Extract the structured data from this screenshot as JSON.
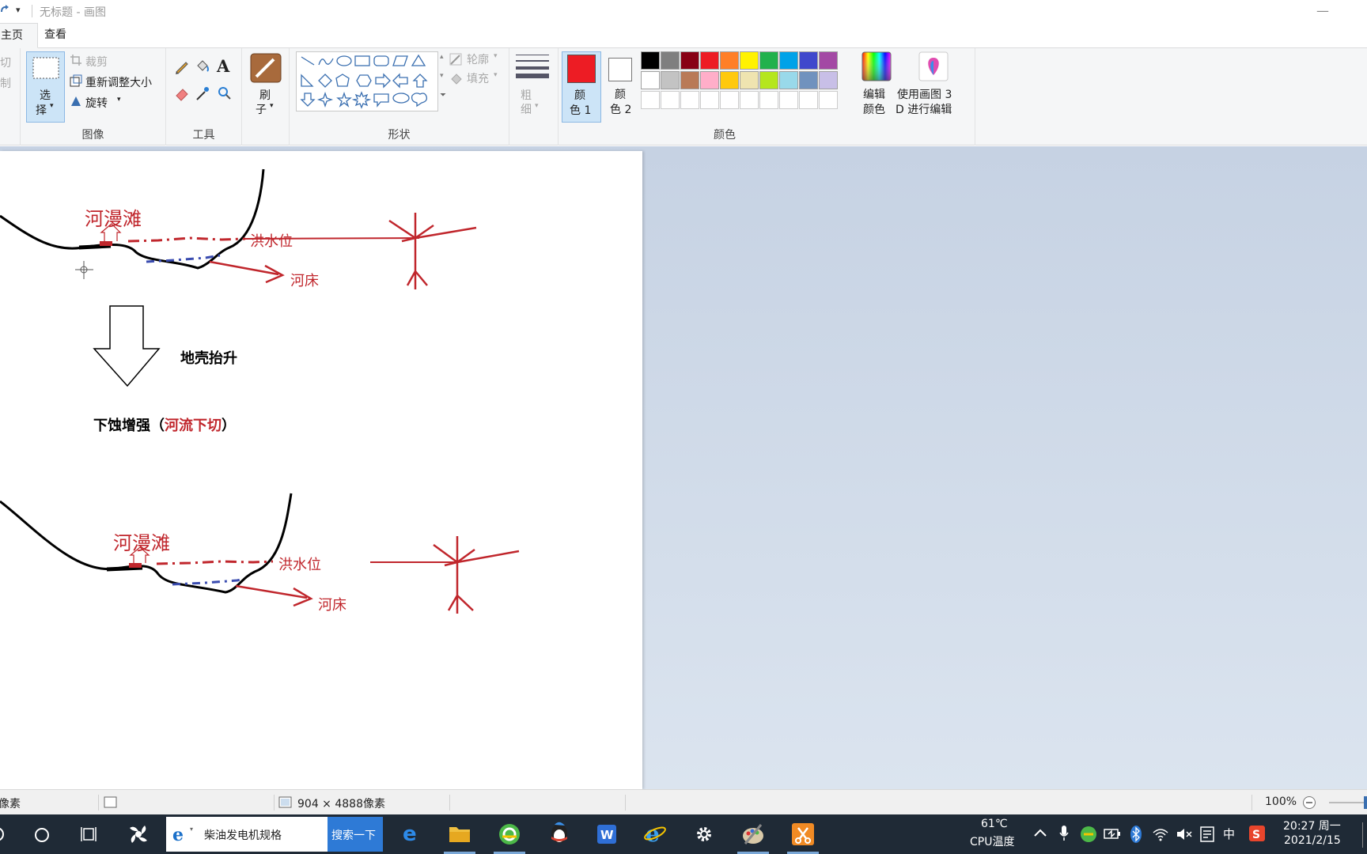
{
  "titlebar": {
    "title": "无标题 - 画图",
    "qat_dropdown": "▾",
    "minimize": "—"
  },
  "tabs": [
    {
      "label": "主页"
    },
    {
      "label": "查看"
    }
  ],
  "ribbon": {
    "clipboard": {
      "cut": "剪切",
      "copy": "复制"
    },
    "image": {
      "select_label": "选择",
      "select_l1": "选",
      "select_l2": "择",
      "crop": "裁剪",
      "resize": "重新调整大小",
      "rotate": "旋转",
      "group_label": "图像"
    },
    "tools": {
      "group_label": "工具",
      "text_glyph": "A"
    },
    "brush": {
      "l1": "刷",
      "l2": "子"
    },
    "shapes": {
      "outline": "轮廓",
      "fill": "填充",
      "group_label": "形状"
    },
    "size": {
      "l1": "粗",
      "l2": "细"
    },
    "colors": {
      "color1_l1": "颜",
      "color1_l2": "色 1",
      "color2_l1": "颜",
      "color2_l2": "色 2",
      "color1": "#ed1c24",
      "color2": "#ffffff",
      "palette_row1": [
        "#000000",
        "#7f7f7f",
        "#880015",
        "#ed1c24",
        "#ff7f27",
        "#fff200",
        "#22b14c",
        "#00a2e8",
        "#3f48cc",
        "#a349a4"
      ],
      "palette_row2": [
        "#ffffff",
        "#c3c3c3",
        "#b97a57",
        "#ffaec9",
        "#ffc90e",
        "#efe4b0",
        "#b5e61d",
        "#99d9ea",
        "#7092be",
        "#c8bfe7"
      ],
      "edit_l1": "编辑",
      "edit_l2": "颜色",
      "group_label": "颜色"
    },
    "paint3d": {
      "l1": "使用画图 3",
      "l2": "D 进行编辑"
    }
  },
  "canvas": {
    "floodplain_1": "河漫滩",
    "flood_level_1": "洪水位",
    "riverbed_1": "河床",
    "uplift": "地壳抬升",
    "downcut_prefix": "下蚀增强（",
    "downcut_red": "河流下切",
    "downcut_suffix": "）",
    "floodplain_2": "河漫滩",
    "flood_level_2": "洪水位",
    "riverbed_2": "河床"
  },
  "statusbar": {
    "position": "像素",
    "dimensions": "904 × 4888像素",
    "zoom": "100%"
  },
  "taskbar": {
    "search_text": "柴油发电机规格",
    "search_button": "搜索一下",
    "temp": "61℃",
    "temp_label": "CPU温度",
    "ime": "中",
    "time": "20:27 周一",
    "date": "2021/2/15"
  }
}
